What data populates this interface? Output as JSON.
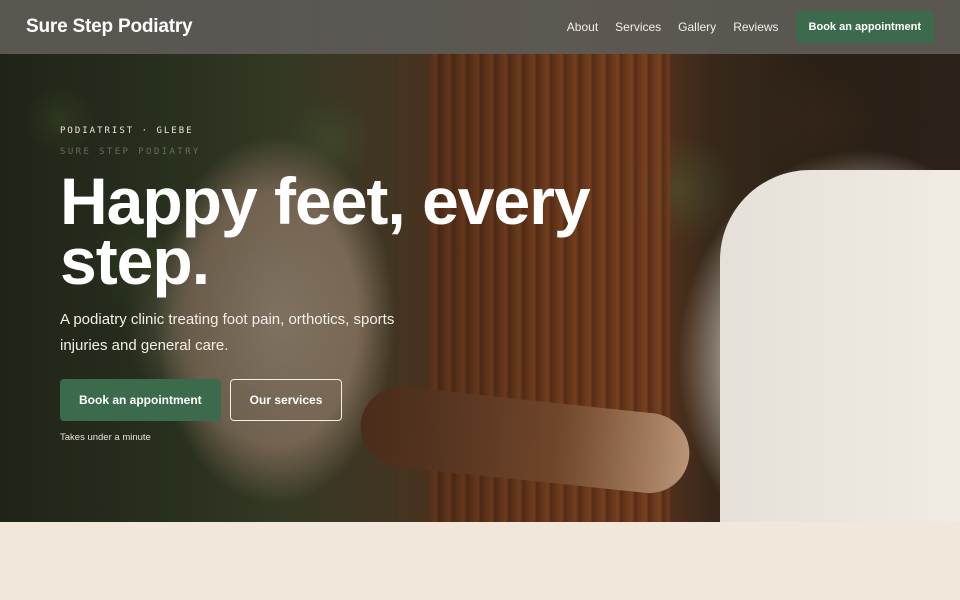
{
  "nav": {
    "brand": "Sure Step Podiatry",
    "links": [
      "About",
      "Services",
      "Gallery",
      "Reviews"
    ],
    "cta": "Book an appointment"
  },
  "hero": {
    "eyebrow": "PODIATRIST · GLEBE",
    "eyebrow_ghost": "SURE STEP PODIATRY",
    "headline_line1": "Happy feet, every",
    "headline_line2": "step.",
    "lede": "A podiatry clinic treating foot pain, orthotics, sports injuries and general care.",
    "primary_button": "Book an appointment",
    "secondary_button": "Our services",
    "note": "Takes under a minute"
  },
  "colors": {
    "accent": "#3b6a4c",
    "nav_background": "#5c5954",
    "page_background": "#f1e7da"
  }
}
